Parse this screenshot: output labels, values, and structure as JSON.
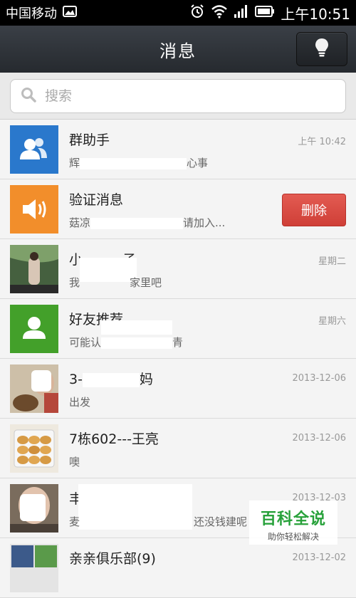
{
  "status_bar": {
    "carrier": "中国移动",
    "time": "上午10:51",
    "icons": [
      "image-icon",
      "alarm-icon",
      "wifi-icon",
      "signal-icon",
      "battery-icon"
    ]
  },
  "title_bar": {
    "title": "消息",
    "bulb_icon": "lightbulb-icon"
  },
  "search": {
    "placeholder": "搜索"
  },
  "conversations": [
    {
      "name": "群助手",
      "preview_start": "辉",
      "preview_end": "心事",
      "time": "上午 10:42",
      "avatar_color": "#2a78cc"
    },
    {
      "name": "验证消息",
      "preview_start": "菇凉",
      "preview_end": "请加入...",
      "delete_label": "删除",
      "avatar_color": "#f28e2b"
    },
    {
      "name": "小",
      "name_tail": "子",
      "preview_start": "我",
      "preview_end": "家里吧",
      "time": "星期二"
    },
    {
      "name": "好友推荐",
      "preview_start": "可能认",
      "preview_end": "青",
      "time": "星期六",
      "avatar_color": "#43a02a"
    },
    {
      "name": "3-",
      "name_tail": "妈",
      "preview_start": "出发",
      "preview_end": "",
      "time": "2013-12-06"
    },
    {
      "name": "7栋602---王亮",
      "preview_start": "噢",
      "preview_end": "",
      "time": "2013-12-06"
    },
    {
      "name": "丰",
      "preview_start": "麦",
      "preview_end": "还没钱建呢",
      "time": "2013-12-03"
    },
    {
      "name": "亲亲俱乐部(9)",
      "preview_start": "",
      "preview_end": "",
      "time": "2013-12-02"
    }
  ],
  "watermark": {
    "title": "百科全说",
    "subtitle": "助你轻松解决"
  }
}
